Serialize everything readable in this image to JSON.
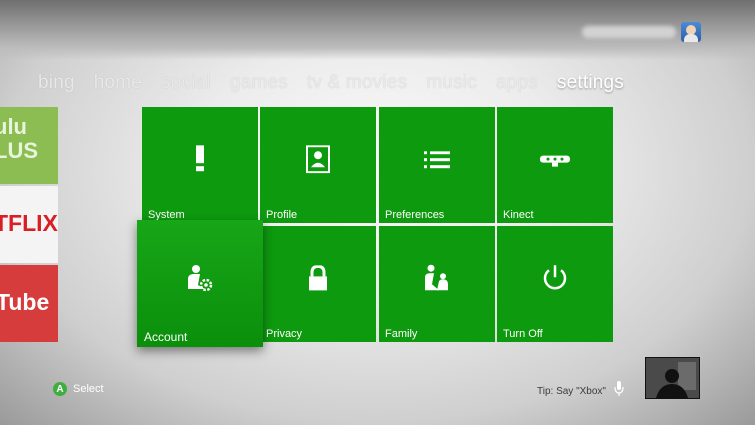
{
  "nav": {
    "items": [
      "bing",
      "home",
      "social",
      "games",
      "tv & movies",
      "music",
      "apps",
      "settings"
    ],
    "active": "settings"
  },
  "ads": {
    "hulu": "ulu\nLUS",
    "netflix": "TFLIX",
    "youtube": "Tube"
  },
  "tiles": [
    {
      "label": "System",
      "icon": "system-icon"
    },
    {
      "label": "Profile",
      "icon": "profile-icon"
    },
    {
      "label": "Preferences",
      "icon": "preferences-icon"
    },
    {
      "label": "Kinect",
      "icon": "kinect-icon"
    },
    {
      "label": "Account",
      "icon": "account-icon"
    },
    {
      "label": "Privacy",
      "icon": "lock-icon"
    },
    {
      "label": "Family",
      "icon": "family-icon"
    },
    {
      "label": "Turn Off",
      "icon": "power-icon"
    }
  ],
  "footer": {
    "button_glyph": "A",
    "select_label": "Select",
    "tip": "Tip: Say \"Xbox\""
  },
  "colors": {
    "tile_green": "#0e9a0e",
    "a_button": "#3fae3f"
  }
}
